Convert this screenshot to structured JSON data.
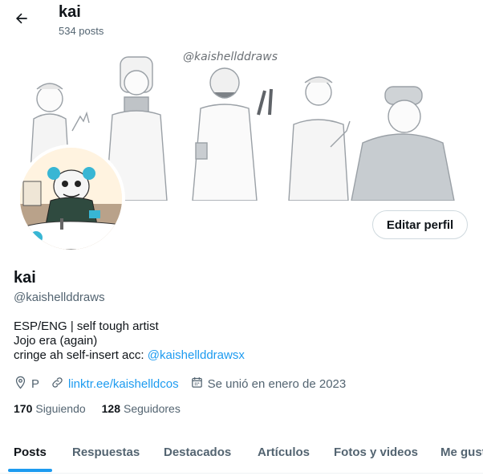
{
  "header": {
    "title": "kai",
    "post_count": "534 posts"
  },
  "banner": {
    "watermark": "@kaishellddraws"
  },
  "profile": {
    "edit_label": "Editar perfil",
    "name": "kai",
    "handle": "@kaishellddraws",
    "bio": {
      "line1": "ESP/ENG | self tough artist",
      "line2": "Jojo era (again)",
      "line3_prefix": "cringe ah self-insert acc: ",
      "line3_mention": "@kaishellddrawsx"
    },
    "meta": {
      "location": "P",
      "link": "linktr.ee/kaishelldcos",
      "joined": "Se unió en enero de 2023"
    },
    "following_count": "170",
    "following_label": "Siguiendo",
    "followers_count": "128",
    "followers_label": "Seguidores"
  },
  "tabs": [
    {
      "label": "Posts",
      "active": true
    },
    {
      "label": "Respuestas",
      "active": false
    },
    {
      "label": "Destacados",
      "active": false
    },
    {
      "label": "Artículos",
      "active": false
    },
    {
      "label": "Fotos y videos",
      "active": false
    },
    {
      "label": "Me gusta",
      "active": false
    }
  ],
  "colors": {
    "accent": "#1d9bf0",
    "text": "#0f1419",
    "secondary_text": "#536471",
    "border": "#cfd9de"
  },
  "icons": {
    "back": "arrow-left-icon",
    "location": "location-pin-icon",
    "link": "link-icon",
    "calendar": "calendar-icon"
  }
}
